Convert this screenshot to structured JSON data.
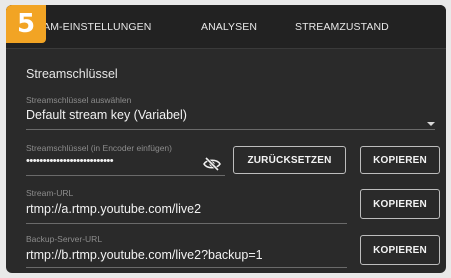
{
  "step_badge": {
    "number": "5",
    "color": "#f2a424"
  },
  "tabs": [
    {
      "label": "EAM-EINSTELLUNGEN"
    },
    {
      "label": "ANALYSEN"
    },
    {
      "label": "STREAMZUSTAND"
    }
  ],
  "stream_key_section": {
    "title": "Streamschlüssel",
    "select": {
      "label": "Streamschlüssel auswählen",
      "selected_value": "Default stream key (Variabel)"
    },
    "key_field": {
      "label": "Streamschlüssel (in Encoder einfügen)",
      "masked_value": "••••••••••••••••••••••••••",
      "visibility_icon": "eye-off-icon"
    },
    "reset_button": "ZURÜCKSETZEN",
    "copy_key_button": "KOPIEREN"
  },
  "stream_url": {
    "label": "Stream-URL",
    "value": "rtmp://a.rtmp.youtube.com/live2",
    "copy_button": "KOPIEREN"
  },
  "backup_url": {
    "label": "Backup-Server-URL",
    "value": "rtmp://b.rtmp.youtube.com/live2?backup=1",
    "copy_button": "KOPIEREN"
  }
}
